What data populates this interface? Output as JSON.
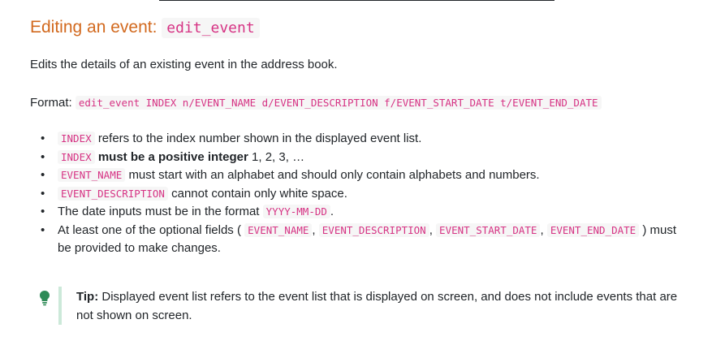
{
  "heading": {
    "text": "Editing an event:",
    "command": "edit_event"
  },
  "description": "Edits the details of an existing event in the address book.",
  "format": {
    "label": "Format:",
    "command": "edit_event INDEX n/EVENT_NAME d/EVENT_DESCRIPTION f/EVENT_START_DATE t/EVENT_END_DATE"
  },
  "rules": [
    {
      "code": "INDEX",
      "text": "refers to the index number shown in the displayed event list."
    },
    {
      "code": "INDEX",
      "bold": "must be a positive integer",
      "text": "1, 2, 3, …"
    },
    {
      "code": "EVENT_NAME",
      "text": "must start with an alphabet and should only contain alphabets and numbers."
    },
    {
      "code": "EVENT_DESCRIPTION",
      "text": "cannot contain only white space."
    },
    {
      "text_before": "The date inputs must be in the format",
      "code": "YYYY-MM-DD",
      "text_after": "."
    },
    {
      "text_before": "At least one of the optional fields (",
      "codes": [
        "EVENT_NAME",
        "EVENT_DESCRIPTION",
        "EVENT_START_DATE",
        "EVENT_END_DATE"
      ],
      "separator": ",",
      "text_after": ") must be provided to make changes."
    }
  ],
  "tip": {
    "icon": "lightbulb-icon",
    "label": "Tip:",
    "text": "Displayed event list refers to the event list that is displayed on screen, and does not include events that are not shown on screen."
  },
  "colors": {
    "heading": "#d2691e",
    "code": "#d63384",
    "code_bg": "#f6f6f6",
    "tip_bar": "#cce9d9",
    "tip_icon": "#2e8b57"
  }
}
